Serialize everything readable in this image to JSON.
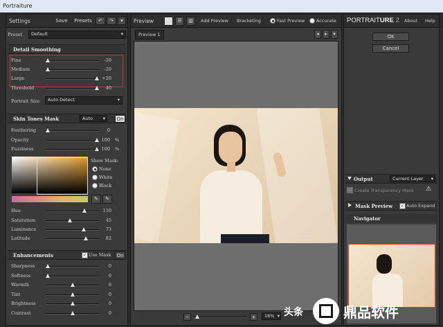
{
  "window": {
    "title": "Portraiture"
  },
  "toolbar": {
    "settings": "Settings",
    "save": "Save",
    "presets": "Presets"
  },
  "preset": {
    "label": "Preset",
    "value": "Default"
  },
  "detail": {
    "title": "Detail Smoothing",
    "rows": [
      {
        "label": "Fine",
        "value": "-20",
        "level": 0.0
      },
      {
        "label": "Medium",
        "value": "-20",
        "level": 0.0
      },
      {
        "label": "Large",
        "value": "+20",
        "level": 1.0
      },
      {
        "label": "Threshold",
        "value": "40",
        "level": 1.0
      }
    ],
    "portrait_size_label": "Portrait Size",
    "portrait_size_value": "Auto Detect"
  },
  "skin": {
    "title": "Skin Tones Mask",
    "mode": "Auto",
    "toggle": "On",
    "rows": [
      {
        "label": "Feathering",
        "value": "0",
        "unit": "",
        "level": 0.0
      },
      {
        "label": "Opacity",
        "value": "100",
        "unit": "%",
        "level": 1.0
      },
      {
        "label": "Fuzziness",
        "value": "100",
        "unit": "%",
        "level": 1.0
      }
    ],
    "show_mask_label": "Show Mask:",
    "show_mask_options": [
      "None",
      "White",
      "Black"
    ],
    "show_mask_selected": 0,
    "hsl": [
      {
        "label": "Hue",
        "value": "150",
        "level": 0.75
      },
      {
        "label": "Saturation",
        "value": "45",
        "level": 0.45
      },
      {
        "label": "Luminance",
        "value": "73",
        "level": 0.73
      },
      {
        "label": "Latitude",
        "value": "82",
        "level": 0.78
      }
    ]
  },
  "enh": {
    "title": "Enhancements",
    "use_mask_label": "Use Mask",
    "toggle": "On",
    "rows": [
      {
        "label": "Sharpness",
        "value": "0",
        "level": 0.0
      },
      {
        "label": "Softness",
        "value": "0",
        "level": 0.0
      },
      {
        "label": "Warmth",
        "value": "0",
        "level": 0.5
      },
      {
        "label": "Tint",
        "value": "0",
        "level": 0.5
      },
      {
        "label": "Brightness",
        "value": "0",
        "level": 0.5
      },
      {
        "label": "Contrast",
        "value": "0",
        "level": 0.5
      }
    ]
  },
  "preview": {
    "title": "Preview",
    "add_preview": "Add Preview",
    "bracketing": "Bracketing",
    "fast_preview": "Fast Preview",
    "accurate": "Accurate",
    "tab": "Preview 1",
    "zoom": "16%"
  },
  "right": {
    "brand_light": "PORTRAIT",
    "brand_bold": "URE",
    "brand_num": "2",
    "about": "About",
    "help": "Help",
    "ok": "OK",
    "cancel": "Cancel",
    "output_label": "Output",
    "output_value": "Current Layer",
    "create_mask": "Create Transparency Mask",
    "mask_preview": "Mask Preview",
    "auto_expand": "Auto Expand",
    "navigator": "Navigator"
  },
  "watermark": {
    "text1": "头条",
    "text2": "鼎品软件"
  },
  "colors": {
    "panel": "#3a3a3a",
    "highlight_box": "#c0392b",
    "photo_bg": "#ecdcc2"
  }
}
